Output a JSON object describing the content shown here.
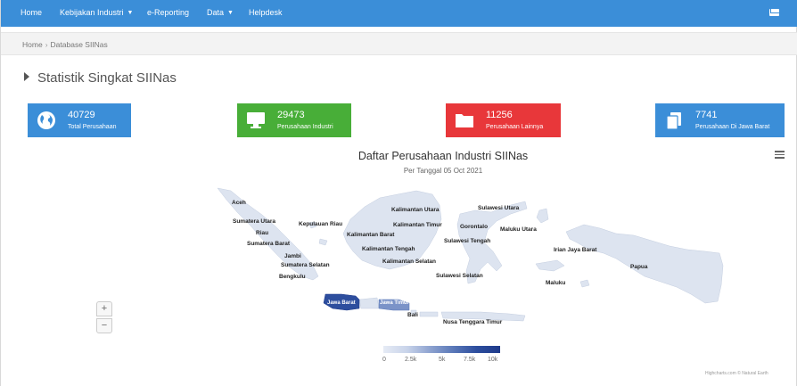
{
  "nav": {
    "home": "Home",
    "kebijakan": "Kebijakan Industri",
    "ereporting": "e-Reporting",
    "data": "Data",
    "helpdesk": "Helpdesk"
  },
  "breadcrumb": {
    "home": "Home",
    "sep": "›",
    "current": "Database SIINas"
  },
  "section": {
    "title": "Statistik Singkat SIINas"
  },
  "stats": [
    {
      "value": "40729",
      "label": "Total Perusahaan",
      "color": "#3b8ed8",
      "icon": "globe-icon"
    },
    {
      "value": "29473",
      "label": "Perusahaan Industri",
      "color": "#48ae38",
      "icon": "monitor-icon"
    },
    {
      "value": "11256",
      "label": "Perusahaan Lainnya",
      "color": "#e8373a",
      "icon": "folder-icon"
    },
    {
      "value": "7741",
      "label": "Perusahaan Di Jawa Barat",
      "color": "#3b8ed8",
      "icon": "copy-icon"
    }
  ],
  "chart": {
    "title": "Daftar Perusahaan Industri SIINas",
    "subtitle": "Per Tanggal 05 Oct 2021",
    "credits": "Highcharts.com © Natural Earth",
    "zoom_in": "+",
    "zoom_out": "−"
  },
  "chart_data": {
    "type": "map",
    "title": "Daftar Perusahaan Industri SIINas",
    "subtitle": "Per Tanggal 05 Oct 2021",
    "color_axis": {
      "min": 0,
      "max": 10000,
      "ticks": [
        "0",
        "2.5k",
        "5k",
        "7.5k",
        "10k"
      ],
      "min_color": "#e6ebf5",
      "max_color": "#1e3a8a"
    },
    "regions": [
      {
        "name": "Aceh"
      },
      {
        "name": "Sumatera Utara"
      },
      {
        "name": "Riau"
      },
      {
        "name": "Sumatera Barat"
      },
      {
        "name": "Jambi"
      },
      {
        "name": "Sumatera Selatan"
      },
      {
        "name": "Bengkulu"
      },
      {
        "name": "Kepulauan Riau"
      },
      {
        "name": "Kalimantan Barat"
      },
      {
        "name": "Kalimantan Utara"
      },
      {
        "name": "Kalimantan Timur"
      },
      {
        "name": "Kalimantan Tengah"
      },
      {
        "name": "Kalimantan Selatan"
      },
      {
        "name": "Sulawesi Utara"
      },
      {
        "name": "Gorontalo"
      },
      {
        "name": "Maluku Utara"
      },
      {
        "name": "Sulawesi Tengah"
      },
      {
        "name": "Sulawesi Selatan"
      },
      {
        "name": "Irian Jaya Barat"
      },
      {
        "name": "Papua"
      },
      {
        "name": "Maluku"
      },
      {
        "name": "Jawa Barat",
        "value": 7741
      },
      {
        "name": "Jawa Timur"
      },
      {
        "name": "Bali"
      },
      {
        "name": "Nusa Tenggara Timur"
      }
    ]
  },
  "colors": {
    "nav": "#3b8ed8",
    "green": "#48ae38",
    "red": "#e8373a",
    "map_base": "#dde4f0",
    "map_dark": "#2d4e9e"
  }
}
